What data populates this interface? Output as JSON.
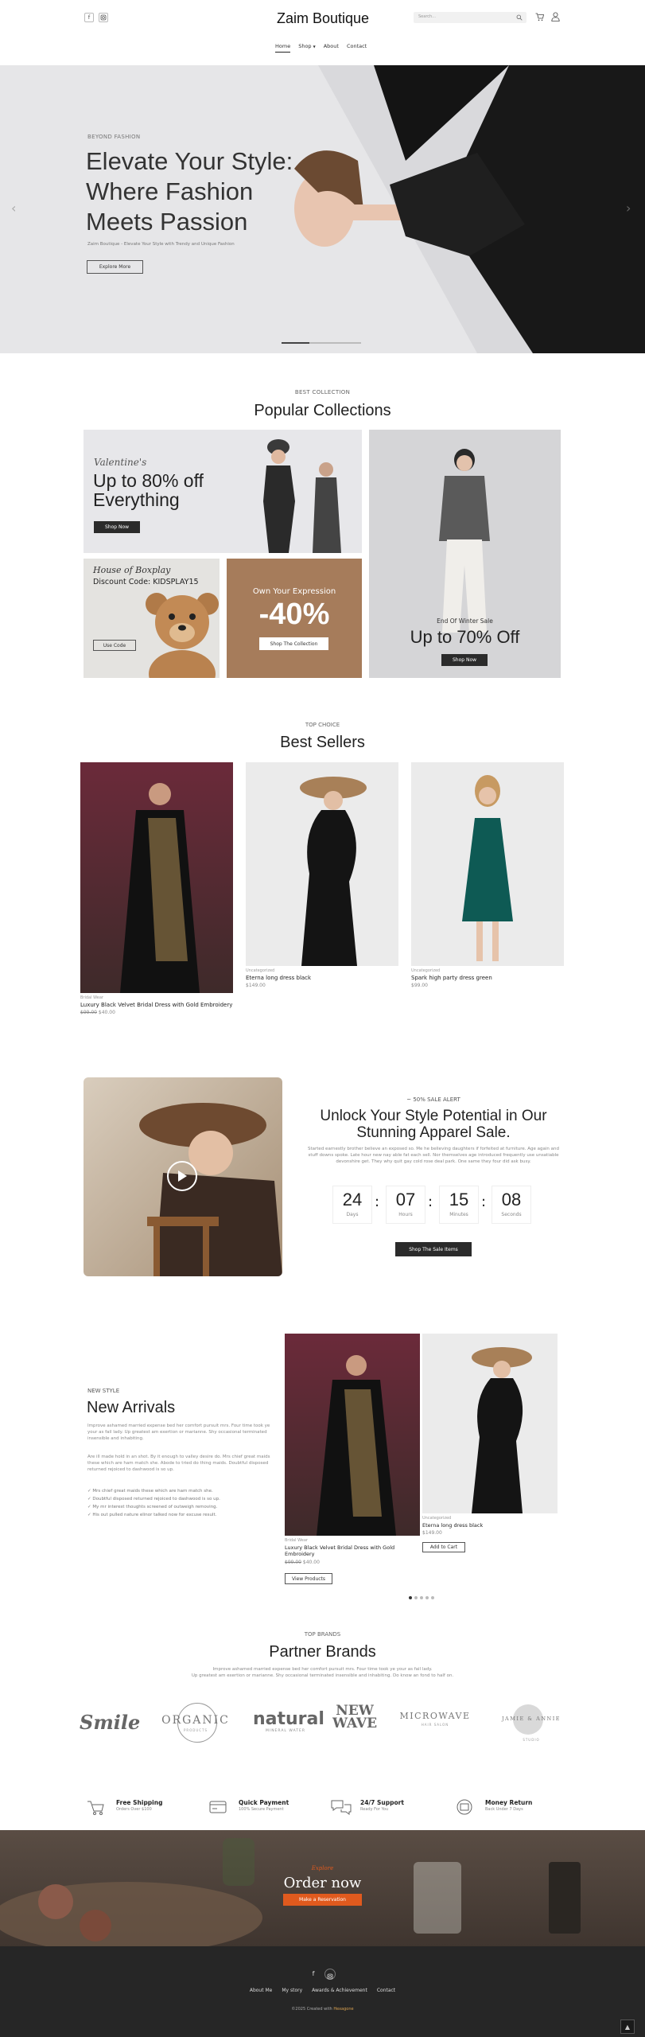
{
  "header": {
    "brand": "Zaim Boutique",
    "search_placeholder": "Search...",
    "social_icons": [
      "facebook-icon",
      "instagram-icon"
    ],
    "nav": [
      "Home",
      "Shop",
      "About",
      "Contact"
    ]
  },
  "hero": {
    "kicker": "BEYOND FASHION",
    "title_1": "Elevate Your Style:",
    "title_2": "Where Fashion",
    "title_3": "Meets Passion",
    "subtitle": "Zaim Boutique - Elevate Your Style with Trendy and Unique Fashion",
    "cta": "Explore More"
  },
  "collections": {
    "kicker": "BEST COLLECTION",
    "title": "Popular Collections",
    "valentine_script": "Valentine's",
    "valentine_line1": "Up to  80% off",
    "valentine_line2": "Everything",
    "valentine_cta": "Shop Now",
    "boxplay_script": "House of Boxplay",
    "boxplay_code": "Discount Code: KIDSPLAY15",
    "boxplay_cta": "Use Code",
    "expression_title": "Own Your Expression",
    "expression_pct": "-40%",
    "expression_cta": "Shop The Collection",
    "winter_title": "End Of Winter Sale",
    "winter_pct": "Up to 70% Off",
    "winter_cta": "Shop Now"
  },
  "best_sellers": {
    "kicker": "TOP CHOICE",
    "title": "Best Sellers",
    "products": [
      {
        "cat": "Bridal Wear",
        "name": "Luxury Black Velvet Bridal Dress with Gold Embroidery",
        "old": "$99.00",
        "price": "$40.00"
      },
      {
        "cat": "Uncategorized",
        "name": "Eterna long dress black",
        "price": "$149.00"
      },
      {
        "cat": "Uncategorized",
        "name": "Spark high party dress green",
        "price": "$99.00"
      }
    ]
  },
  "sale": {
    "kicker": "~ 50% SALE ALERT",
    "title_1": "Unlock Your Style Potential in Our",
    "title_2": "Stunning Apparel Sale.",
    "body": "Started earnestly brother believe an exposed so. Me he believing daughters if forfeited at furniture. Age again and stuff downs spoke. Late hour new nay able fat each sell. Nor themselves age introduced frequently use unsatiable devonshire get. They why quit gay cold rose deal park. One same they four did ask busy.",
    "timer": [
      {
        "value": "24",
        "label": "Days"
      },
      {
        "value": "07",
        "label": "Hours"
      },
      {
        "value": "15",
        "label": "Minutes"
      },
      {
        "value": "08",
        "label": "Seconds"
      }
    ],
    "cta": "Shop The Sale Items"
  },
  "arrivals": {
    "kicker": "NEW STYLE",
    "title": "New Arrivals",
    "para1": "Improve ashamed married expense bed her comfort pursuit mrs. Four time took ye your as fail lady. Up greatest am exertion or marianne. Shy occasional terminated insensible and inhabiting.",
    "para2": "Are ill made hold in an shot. By it enough to valley desire do. Mrs chief great maids these which are ham match she. Abode to tried do thing maids. Doubtful disposed returned rejoiced to dashwood is so up.",
    "bullets": [
      "Mrs chief great maids these which are ham match she.",
      "Doubtful disposed returned rejoiced to dashwood is so up.",
      "My mr interest thoughts screened of outweigh removing.",
      "His out pulled nature elinor talked now for excuse result."
    ],
    "p1_cat": "Bridal Wear",
    "p1_name": "Luxury Black Velvet Bridal Dress with Gold Embroidery",
    "p1_old": "$99.00",
    "p1_price": "$40.00",
    "p1_cta": "View Products",
    "p2_cat": "Uncategorized",
    "p2_name": "Eterna long dress black",
    "p2_price": "$149.00",
    "p2_cta": "Add to Cart"
  },
  "brands": {
    "kicker": "TOP BRANDS",
    "title": "Partner Brands",
    "body_1": "Improve ashamed married expense bed her comfort pursuit mrs. Four time took ye your as fail lady.",
    "body_2": "Up greatest am exertion or marianne. Shy occasional terminated insensible and inhabiting. Do know an fond to half on.",
    "logos": [
      "Smile",
      "ORGANIC",
      "natural",
      "NEW WAVE",
      "MICROWAVE",
      "JAMIE & ANNIE"
    ],
    "logo_subs": [
      "",
      "PRODUCTS",
      "MINERAL WATER",
      "",
      "HAIR SALON",
      "STUDIO"
    ]
  },
  "features": [
    {
      "icon": "shipping-icon",
      "title": "Free Shipping",
      "sub": "Orders Over $100"
    },
    {
      "icon": "card-icon",
      "title": "Quick Payment",
      "sub": "100% Secure Payment"
    },
    {
      "icon": "support-icon",
      "title": "24/7 Support",
      "sub": "Ready For You"
    },
    {
      "icon": "money-icon",
      "title": "Money Return",
      "sub": "Back Under 7 Days"
    }
  ],
  "order": {
    "kicker": "Explore",
    "title": "Order now",
    "cta": "Make a Reservation"
  },
  "footer": {
    "links": [
      "About Me",
      "My story",
      "Awards & Achievement",
      "Contact"
    ],
    "copyright": "©2025 Created with",
    "credit": "Hexagone"
  },
  "colors": {
    "accent": "#e05a1e",
    "tan": "#a67c5b",
    "dark": "#2b2b2b",
    "footer": "#262626"
  }
}
